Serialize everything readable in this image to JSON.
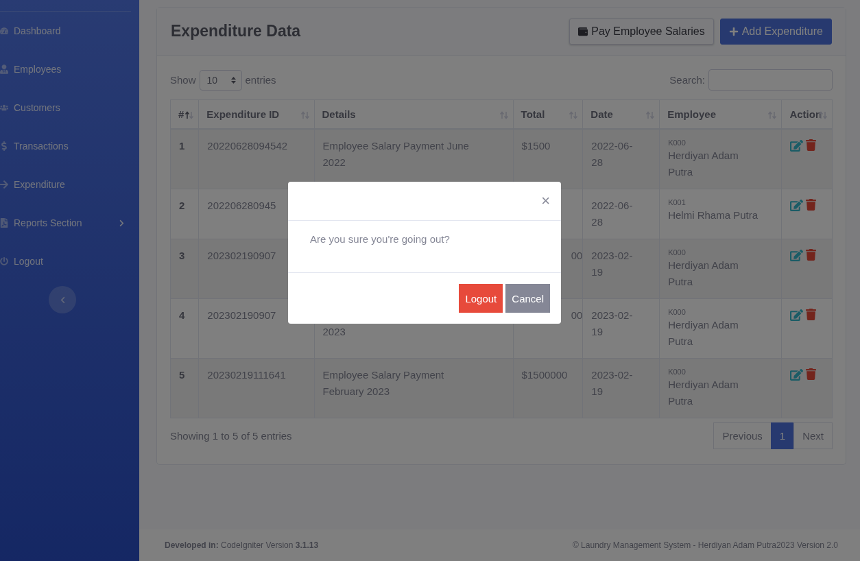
{
  "sidebar": {
    "items": [
      {
        "label": "Dashboard",
        "expandable": false
      },
      {
        "label": "Employees",
        "expandable": false
      },
      {
        "label": "Customers",
        "expandable": false
      },
      {
        "label": "Transactions",
        "expandable": false
      },
      {
        "label": "Expenditure",
        "expandable": false
      },
      {
        "label": "Reports Section",
        "expandable": true
      },
      {
        "label": "Logout",
        "expandable": false
      }
    ]
  },
  "card": {
    "title": "Expenditure Data",
    "buttons": [
      {
        "label": "Pay Employee Salaries",
        "kind": "light"
      },
      {
        "label": "Add Expenditure",
        "kind": "primary"
      }
    ]
  },
  "length": {
    "label_before": "Show",
    "value": "10",
    "label_after": "entries"
  },
  "search": {
    "label": "Search:"
  },
  "table": {
    "columns": [
      {
        "label": "#",
        "sorted": true
      },
      {
        "label": "Expenditure ID",
        "sorted": false
      },
      {
        "label": "Details",
        "sorted": false
      },
      {
        "label": "Total",
        "sorted": false
      },
      {
        "label": "Date",
        "sorted": false
      },
      {
        "label": "Employee",
        "sorted": false
      },
      {
        "label": "Action",
        "sorted": false
      }
    ],
    "rows": [
      {
        "no": "1",
        "id": "20220628094542",
        "details": "Employee Salary Payment June 2022",
        "total": "$1500",
        "date": "2022-06-28",
        "code": "K000",
        "name": "Herdiyan Adam Putra"
      },
      {
        "no": "2",
        "id": "202206280945",
        "date": "2022-06-28",
        "code": "K001",
        "name": "Helmi Rhama Putra"
      },
      {
        "no": "3",
        "id": "202302190907",
        "total_tail": "00",
        "date": "2023-02-19",
        "code": "K000",
        "name": "Herdiyan Adam Putra"
      },
      {
        "no": "4",
        "id": "202302190907",
        "details_tail": "2023",
        "total_tail": "00",
        "date": "2023-02-19",
        "code": "K000",
        "name": "Herdiyan Adam Putra"
      },
      {
        "no": "5",
        "id": "20230219111641",
        "details": "Employee Salary Payment February 2023",
        "total": "$1500000",
        "date": "2023-02-19",
        "code": "K000",
        "name": "Herdiyan Adam Putra"
      }
    ]
  },
  "info": "Showing 1 to 5 of 5 entries",
  "pagination": [
    {
      "label": "Previous",
      "selected": false
    },
    {
      "label": "1",
      "selected": true
    },
    {
      "label": "Next",
      "selected": false
    }
  ],
  "footer": {
    "left": "**Developed in:** CodeIgniter Version **3.1.13**",
    "right": "© Laundry Management System - Herdiyan Adam Putra2023 Version 2.0"
  },
  "modal": {
    "close": "×",
    "message": "Are you sure you're going out?",
    "buttons": [
      {
        "label": "Logout",
        "kind": "danger"
      },
      {
        "label": "Cancel",
        "kind": "secondary"
      }
    ]
  }
}
